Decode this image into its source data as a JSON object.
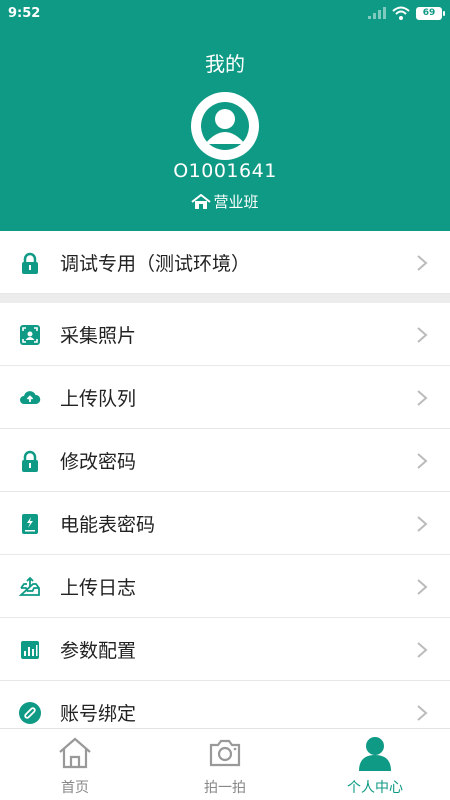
{
  "status_bar": {
    "time": "9:52",
    "battery": "69"
  },
  "header": {
    "title": "我的",
    "user_id": "O1001641",
    "department": "营业班"
  },
  "debug_item": {
    "label": "调试专用（测试环境）"
  },
  "menu": [
    {
      "label": "采集照片",
      "icon": "photo-capture-icon"
    },
    {
      "label": "上传队列",
      "icon": "cloud-upload-icon"
    },
    {
      "label": "修改密码",
      "icon": "lock-icon"
    },
    {
      "label": "电能表密码",
      "icon": "meter-icon"
    },
    {
      "label": "上传日志",
      "icon": "tray-upload-icon"
    },
    {
      "label": "参数配置",
      "icon": "bar-chart-icon"
    },
    {
      "label": "账号绑定",
      "icon": "link-icon"
    }
  ],
  "tabs": [
    {
      "label": "首页",
      "icon": "home-icon"
    },
    {
      "label": "拍一拍",
      "icon": "camera-icon"
    },
    {
      "label": "个人中心",
      "icon": "person-icon",
      "active": true
    }
  ],
  "colors": {
    "accent": "#0f9a85",
    "tab_inactive": "#888888"
  }
}
